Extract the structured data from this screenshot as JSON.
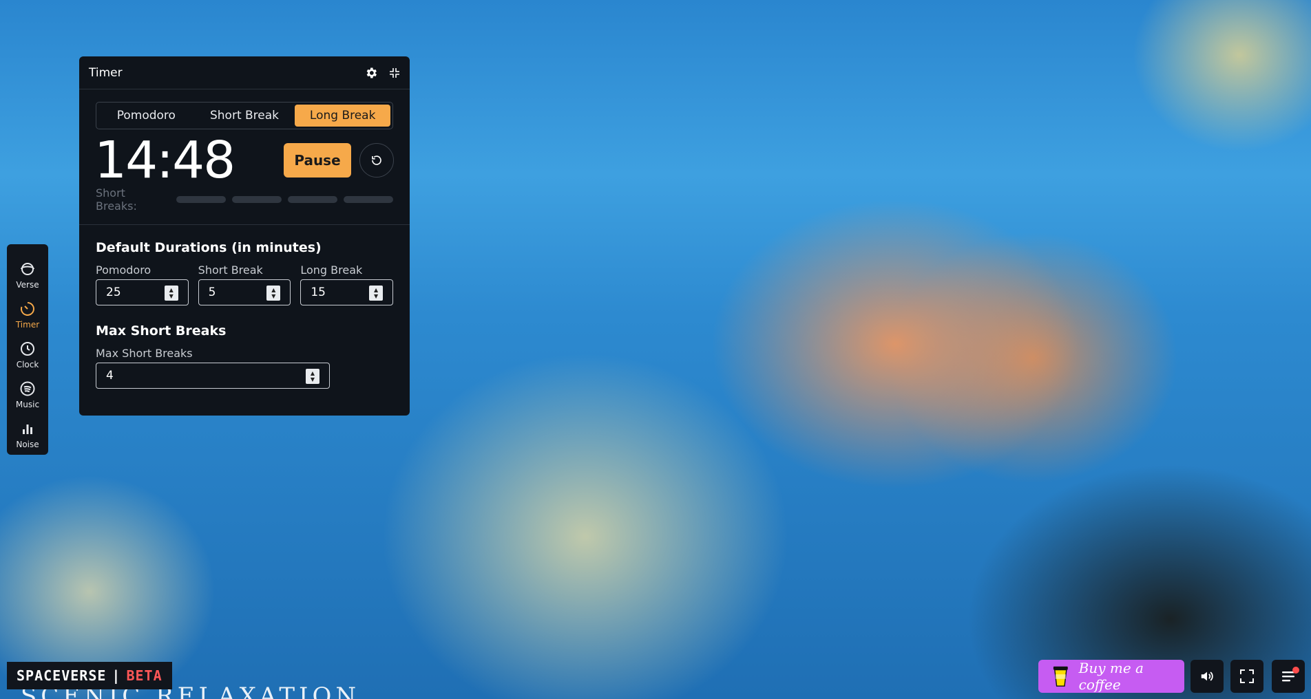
{
  "panel": {
    "title": "Timer",
    "tabs": [
      {
        "label": "Pomodoro",
        "active": false
      },
      {
        "label": "Short Break",
        "active": false
      },
      {
        "label": "Long Break",
        "active": true
      }
    ],
    "time": "14:48",
    "pause_label": "Pause",
    "short_breaks_label": "Short Breaks:",
    "short_breaks_completed": 0,
    "short_breaks_total": 4,
    "defaults_title": "Default Durations (in minutes)",
    "fields": [
      {
        "label": "Pomodoro",
        "value": "25"
      },
      {
        "label": "Short Break",
        "value": "5"
      },
      {
        "label": "Long Break",
        "value": "15"
      }
    ],
    "max_title": "Max Short Breaks",
    "max_label": "Max Short Breaks",
    "max_value": "4"
  },
  "sidenav": {
    "items": [
      {
        "label": "Verse",
        "icon": "planet-icon",
        "active": false
      },
      {
        "label": "Timer",
        "icon": "timer-icon",
        "active": true
      },
      {
        "label": "Clock",
        "icon": "clock-icon",
        "active": false
      },
      {
        "label": "Music",
        "icon": "spotify-icon",
        "active": false
      },
      {
        "label": "Noise",
        "icon": "bar-chart-icon",
        "active": false
      }
    ]
  },
  "brand": {
    "name": "SPACEVERSE",
    "separator": "|",
    "beta": "BETA"
  },
  "scene_caption": "SCENIC RELAXATION",
  "footer": {
    "coffee_label": "Buy me a coffee"
  },
  "colors": {
    "accent": "#f6a94a",
    "panel": "#0f141b",
    "coffee": "#c65cf2",
    "beta": "#ff5757"
  }
}
